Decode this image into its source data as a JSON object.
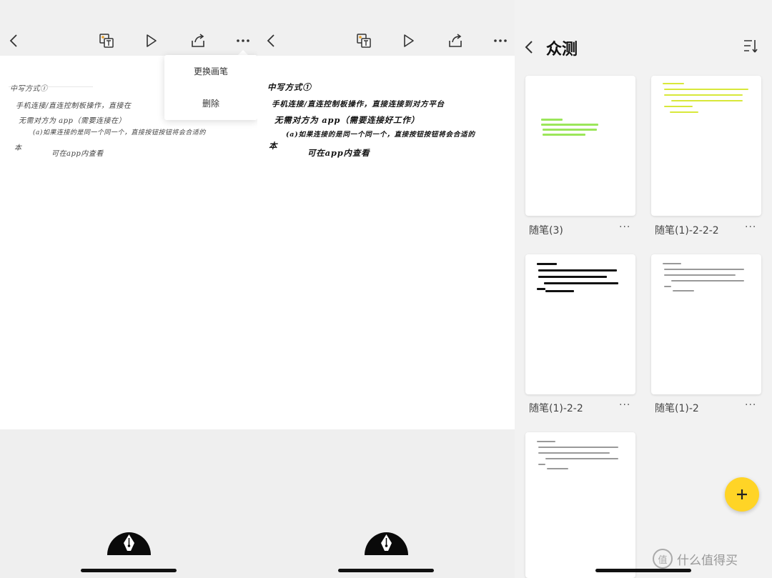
{
  "left_editor": {
    "menu": {
      "item1": "更换画笔",
      "item2": "删除"
    },
    "handwriting": [
      "中写方式①",
      "手机连接/直连控制板操作，直接在",
      "无需对方为 app（需要连接在）",
      "(a)如果连接的是同一个同一个，直接按钮按钮将会合适的",
      "本",
      "可在app内查看"
    ]
  },
  "middle_editor": {
    "handwriting": [
      "中写方式①",
      "手机连接/直连控制板操作，直接连接到对方平台",
      "无需对方为 app（需要连接好工作）",
      "(a)如果连接的是同一个同一个，直接按钮按钮将会合适的",
      "本",
      "可在app内查看"
    ]
  },
  "notebook": {
    "title": "众测",
    "cards": [
      {
        "label": "随笔(3)",
        "more": "···",
        "style": "highlight"
      },
      {
        "label": "随笔(1)-2-2-2",
        "more": "···",
        "style": "yellow"
      },
      {
        "label": "随笔(1)-2-2",
        "more": "···",
        "style": "black"
      },
      {
        "label": "随笔(1)-2",
        "more": "···",
        "style": "gray"
      },
      {
        "label": "",
        "more": "",
        "style": "gray"
      }
    ],
    "fab_icon": "plus-icon",
    "watermark": {
      "badge": "值",
      "text": "什么值得买"
    }
  },
  "colors": {
    "accent_yellow": "#ffd426",
    "highlight_green": "#9be65a",
    "ink_yellow": "#d8e83a"
  }
}
